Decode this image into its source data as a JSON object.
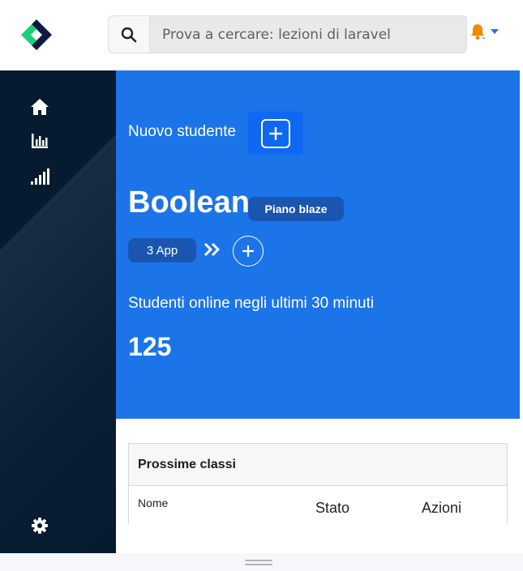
{
  "header": {
    "search": {
      "placeholder": "Prova a cercare: lezioni di laravel"
    },
    "icons": {
      "logo": "brand-logo",
      "search": "search-icon",
      "notification": "bell-icon",
      "dropdown": "caret-down-icon"
    }
  },
  "sidebar": {
    "items": [
      {
        "icon": "home-icon"
      },
      {
        "icon": "bar-chart-icon"
      },
      {
        "icon": "signal-icon"
      }
    ],
    "settings_icon": "gear-icon"
  },
  "hero": {
    "new_student_label": "Nuovo studente",
    "company_name": "Boolean",
    "plan_label": "Piano blaze",
    "apps_label": "3 App",
    "online_label": "Studenti online negli ultimi 30 minuti",
    "online_count": "125"
  },
  "classes_card": {
    "title": "Prossime classi",
    "columns": [
      "Nome",
      "Stato",
      "Azioni"
    ]
  },
  "colors": {
    "hero_bg": "#1c74e9",
    "sidebar_bg": "#061a30",
    "logo_green": "#1ccf7a",
    "logo_navy": "#0d1b3e",
    "bell": "#f18a00",
    "caret": "#1c74e9"
  }
}
